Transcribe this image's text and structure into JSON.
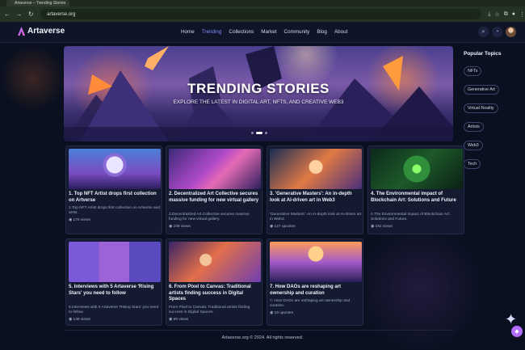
{
  "browser": {
    "tab_title": "Artaverse – Trending Stories",
    "url": "artaverse.org",
    "back_glyph": "←",
    "forward_glyph": "→",
    "reload_glyph": "↻",
    "icons": [
      "download-icon",
      "star-icon",
      "extensions-icon",
      "profile-icon",
      "menu-icon"
    ]
  },
  "site": {
    "name": "Artaverse",
    "nav": [
      "Home",
      "Trending",
      "Collections",
      "Market",
      "Community",
      "Blog",
      "About"
    ],
    "active_nav": "Trending",
    "accent": "#7c8cff"
  },
  "hero": {
    "title": "TRENDING STORIES",
    "subtitle": "EXPLORE THE LATEST IN DIGITAL ART, NFTS, AND CREATIVE WEB3",
    "slides": 3,
    "active_slide": 1
  },
  "sidebar": {
    "title": "Popular Topics",
    "topics": [
      "NFTs",
      "Generative Art",
      "Virtual Reality",
      "Artists",
      "Web3",
      "Tech"
    ]
  },
  "cards": [
    {
      "title": "1. Top NFT Artist drops first collection on Artverse",
      "desc": "1.Top NFT Artist drops first collection on Artverse and artist.",
      "stat": "176 views"
    },
    {
      "title": "2. Decentralized Art Collective secures massive funding for new virtual gallery",
      "desc": "2.Decentralized Art Collective secures massive funding for new virtual gallery.",
      "stat": "238 views"
    },
    {
      "title": "3. 'Generative Masters': An in-depth look at AI-driven art in Web3",
      "desc": "'Generative Masters': An in-depth look at AI-driven art in Web3.",
      "stat": "127 upvotes"
    },
    {
      "title": "4. The Environmental impact of Blockchain Art: Solutions and Future",
      "desc": "4.The Environmental impact of Blockchain Art: Solutions and Future.",
      "stat": "182 views"
    },
    {
      "title": "5. Interviews with 5 Artaverse 'Rising Stars' you need to follow",
      "desc": "5.Interviews with 5 Artaverse 'Rising Stars' you need to follow.",
      "stat": "136 views"
    },
    {
      "title": "6. From Pixel to Canvas: Traditional artists finding success in Digital Spaces",
      "desc": "From Pixel to Canvas: Traditional artists finding success in Digital Spaces.",
      "stat": "99 views"
    },
    {
      "title": "7. How DAOs are reshaping art ownership and curation",
      "desc": "7. How DAOs are reshaping art ownership and curation.",
      "stat": "19 upvotes"
    }
  ],
  "footer": "Artaverse.org © 2024. All rights reserved."
}
